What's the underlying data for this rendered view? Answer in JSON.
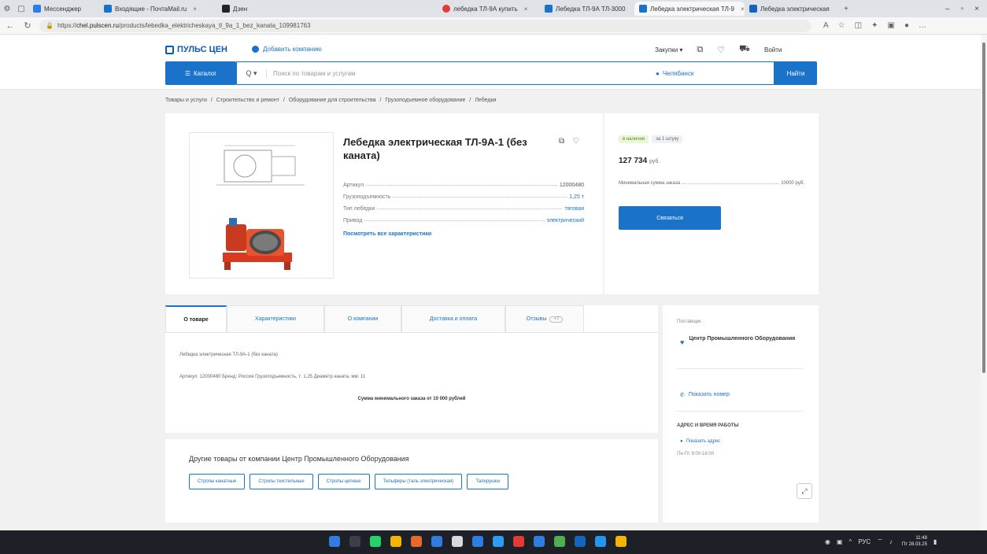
{
  "browser": {
    "tabs": [
      {
        "label": "Мессенджер",
        "color": "#2b7de9",
        "active": false
      },
      {
        "label": "Входящие - ПочтаMail.ru",
        "color": "#1a73c9",
        "active": false
      },
      {
        "label": "Дзен",
        "color": "#222222",
        "active": false
      },
      {
        "label": "лебедка ТЛ-9А купить",
        "color": "#e53935",
        "active": false
      },
      {
        "label": "Лебедка ТЛ-9А ТЛ-3000",
        "color": "#1a73c9",
        "active": false
      },
      {
        "label": "Лебедка электрическая ТЛ-9",
        "color": "#1a73c9",
        "active": true
      },
      {
        "label": "Лебедка электрическая",
        "color": "#1565c0",
        "active": false
      }
    ],
    "url_prefix": "https://",
    "url_host": "chel.pulscen.ru",
    "url_path": "/products/lebedka_elektricheskaya_tl_9a_1_bez_kanata_109981763"
  },
  "header": {
    "logo": "ПУЛЬС ЦЕН",
    "add_company": "Добавить компанию",
    "purchases": "Закупки",
    "login": "Войти",
    "catalog": "Каталог",
    "search_scope": "Q",
    "search_placeholder": "Поиск по товарам и услугам",
    "city": "Челябинск",
    "search_button": "Найти"
  },
  "breadcrumb": [
    "Товары и услуги",
    "/",
    "Строительство и ремонт",
    "/",
    "Оборудование для строительства",
    "/",
    "Грузоподъемное оборудование",
    "/",
    "Лебедки"
  ],
  "product": {
    "title": "Лебедка электрическая ТЛ-9А-1 (без каната)",
    "specs": [
      {
        "key": "Артикул",
        "value": "12000480",
        "link": false
      },
      {
        "key": "Грузоподъемность",
        "value": "1,25 т",
        "link": true
      },
      {
        "key": "Тип лебедки",
        "value": "тяговая",
        "link": true
      },
      {
        "key": "Привод",
        "value": "электрический",
        "link": true
      }
    ],
    "all_specs_link": "Посмотреть все характеристики"
  },
  "offer": {
    "badge_stock": "в наличии",
    "badge_unit": "за 1 штуку",
    "price": "127 734",
    "currency": "руб.",
    "min_order_label": "Минимальная сумма заказа",
    "min_order_value": "10000 руб.",
    "buy_button": "Связаться"
  },
  "tabs": [
    {
      "label": "О товаре",
      "active": true
    },
    {
      "label": "Характеристики",
      "active": false
    },
    {
      "label": "О компании",
      "active": false
    },
    {
      "label": "Доставка и оплата",
      "active": false
    },
    {
      "label": "Отзывы",
      "active": false,
      "count": "+7"
    }
  ],
  "description": {
    "line1": "Лебедка электрическая ТЛ-9А-1 (без каната)",
    "line2": "Артикул: 12000480 Бренд: Россия Грузоподъемность, т: 1,25 Диаметр каната, мм: 11",
    "min_sum": "Сумма минимального заказа от 10 000 рублей"
  },
  "other_goods": {
    "title": "Другие товары от компании Центр Промышленного Оборудования",
    "chips": [
      "Стропы канатные",
      "Стропы текстильные",
      "Стропы цепные",
      "Тельферы (таль электрическая)",
      "Талерушки"
    ]
  },
  "seller": {
    "label": "Поставщик",
    "name": "Центр Промышленного Оборудования",
    "phone": "Показать номер",
    "address_title": "АДРЕС И ВРЕМЯ РАБОТЫ",
    "show_address": "Показать адрес",
    "hours": "Пн-Пт 9:00-18:00"
  },
  "taskbar": {
    "apps": [
      "#2f7de1",
      "#3a3f48",
      "#25d366",
      "#f4b400",
      "#e66a2c",
      "#2f7de1",
      "#d9d9d9",
      "#2f7de1",
      "#2a9df4",
      "#e53935",
      "#2f7de1",
      "#4caf50",
      "#1565c0",
      "#2196f3",
      "#f4b400"
    ],
    "lang": "РУС",
    "time": "11:48",
    "date": "Пт 28.03.25"
  }
}
